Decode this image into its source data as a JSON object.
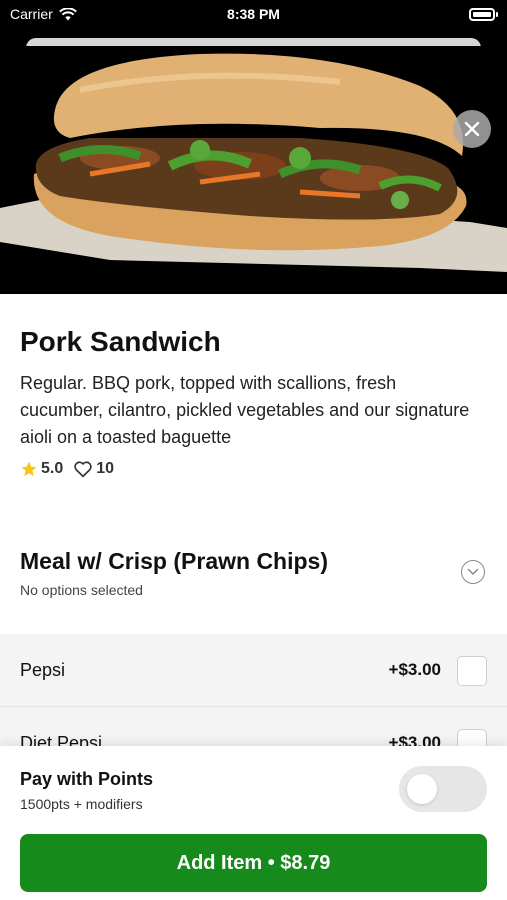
{
  "status_bar": {
    "carrier": "Carrier",
    "time": "8:38 PM",
    "battery_level": 1.0
  },
  "hero": {
    "image_alt": "pork-sandwich-photo",
    "close_icon": "close-icon"
  },
  "product": {
    "title": "Pork Sandwich",
    "description": "Regular. BBQ pork, topped with scallions, fresh cucumber, cilantro, pickled vegetables and our signature aioli on a toasted baguette",
    "rating": "5.0",
    "likes": "10"
  },
  "modifier_group": {
    "title": "Meal w/ Crisp (Prawn Chips)",
    "subtitle": "No options selected",
    "options": [
      {
        "name": "Pepsi",
        "price": "+$3.00"
      },
      {
        "name": "Diet Pepsi",
        "price": "+$3.00"
      }
    ]
  },
  "footer": {
    "points_title": "Pay with Points",
    "points_subtitle": "1500pts + modifiers",
    "toggle_on": false,
    "add_button": "Add Item • $8.79"
  },
  "colors": {
    "accent": "#168a1a",
    "star": "#f5c518"
  }
}
